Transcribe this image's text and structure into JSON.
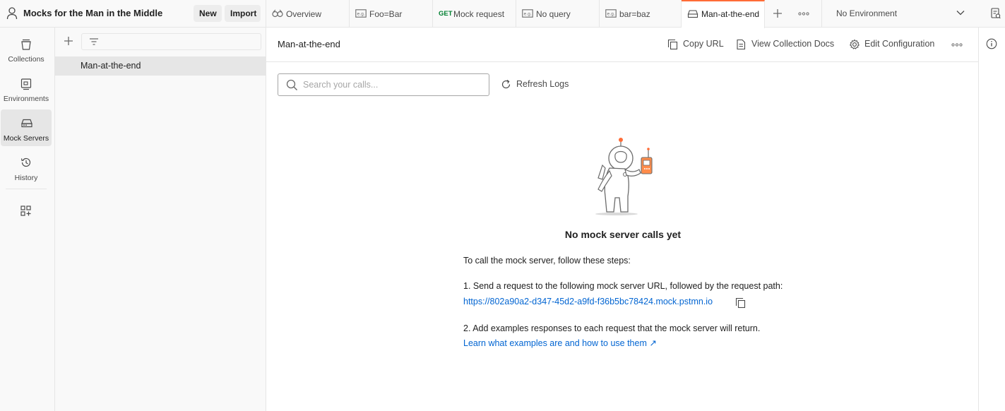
{
  "workspace": {
    "title": "Mocks for the Man in the Middle",
    "new_label": "New",
    "import_label": "Import"
  },
  "rail": {
    "items": [
      {
        "label": "Collections",
        "icon": "collections-icon"
      },
      {
        "label": "Environments",
        "icon": "environments-icon"
      },
      {
        "label": "Mock Servers",
        "icon": "mock-servers-icon",
        "active": true
      },
      {
        "label": "History",
        "icon": "history-icon"
      }
    ],
    "apps_icon": "configure-workbench-icon"
  },
  "sidebar": {
    "filter_placeholder": "",
    "items": [
      {
        "label": "Man-at-the-end",
        "selected": true
      }
    ]
  },
  "tabs": [
    {
      "label": "Overview",
      "icon": "overview-icon"
    },
    {
      "label": "Foo=Bar",
      "icon": "example-icon"
    },
    {
      "method": "GET",
      "label": "Mock request"
    },
    {
      "label": "No query",
      "icon": "example-icon"
    },
    {
      "label": "bar=baz",
      "icon": "example-icon"
    },
    {
      "label": "Man-at-the-end",
      "icon": "mock-server-icon",
      "active": true
    }
  ],
  "environment": {
    "selected": "No Environment"
  },
  "main": {
    "title": "Man-at-the-end",
    "actions": {
      "copy_url": "Copy URL",
      "view_docs": "View Collection Docs",
      "edit_config": "Edit Configuration"
    },
    "search_placeholder": "Search your calls...",
    "refresh_label": "Refresh Logs",
    "empty": {
      "title": "No mock server calls yet",
      "intro": "To call the mock server, follow these steps:",
      "step1": "1. Send a request to the following mock server URL, followed by the request path:",
      "mock_url": "https://802a90a2-d347-45d2-a9fd-f36b5bc78424.mock.pstmn.io",
      "step2": "2. Add examples responses to each request that the mock server will return.",
      "learn_link": "Learn what examples are and how to use them ↗"
    }
  },
  "colors": {
    "accent": "#ff6c37",
    "link": "#0265d2",
    "get_method": "#007f31",
    "sidebar_bg": "#f9f9f9",
    "selected_bg": "#e6e6e6"
  }
}
